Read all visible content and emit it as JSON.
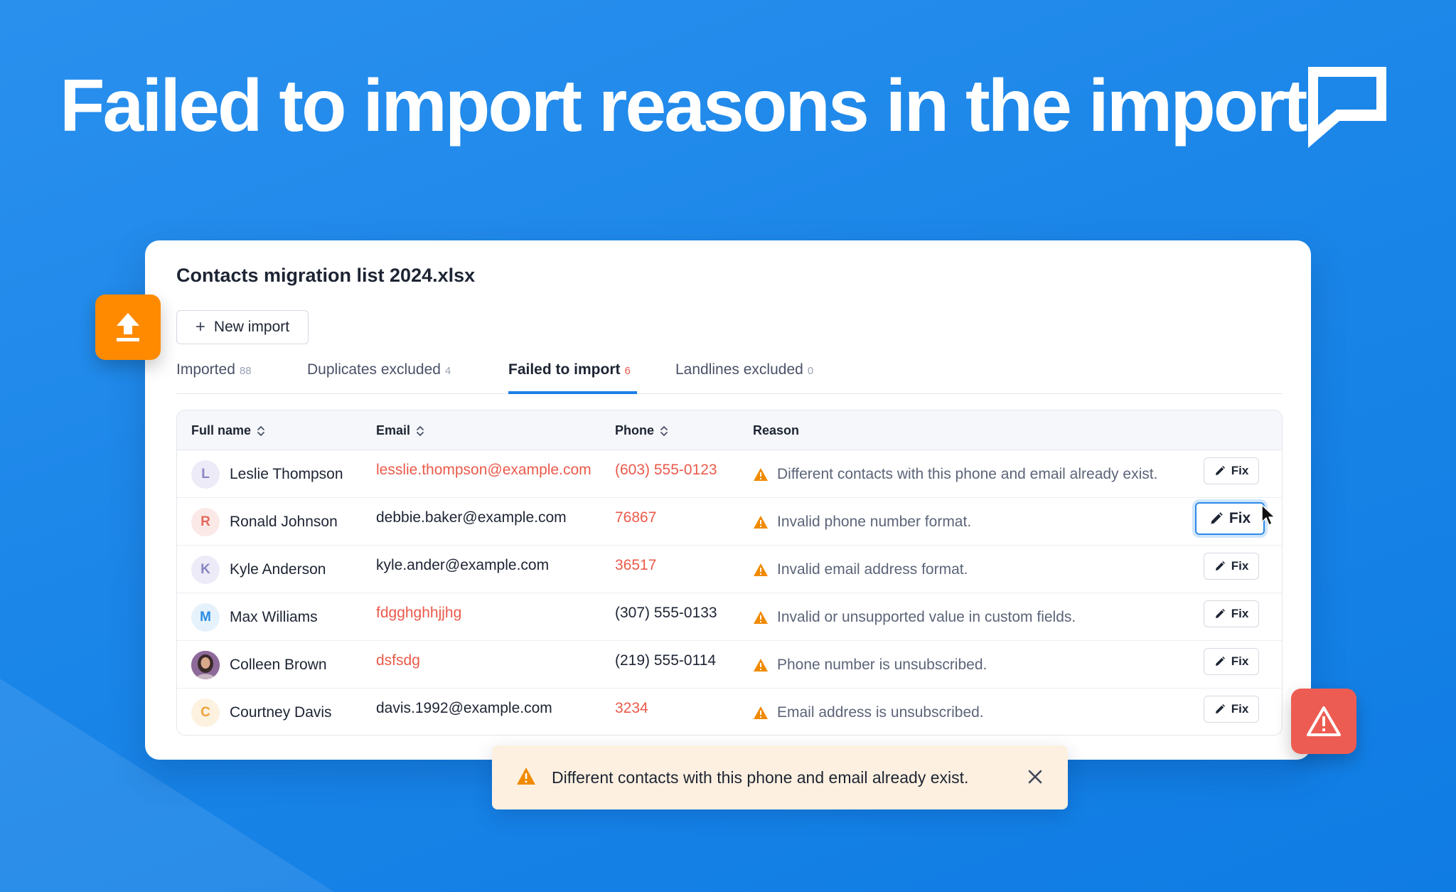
{
  "headline": "Failed to import reasons in the import",
  "colors": {
    "accent_blue": "#1a7fe6",
    "error_red": "#ea5a4a",
    "warning_orange": "#f08a00",
    "upload_orange": "#ff8a00",
    "alert_red": "#ed5c52",
    "toast_bg": "#fdf0e0"
  },
  "card": {
    "file_title": "Contacts migration list 2024.xlsx",
    "new_import_label": "New import",
    "tabs": [
      {
        "label": "Imported",
        "count": "88",
        "active": false
      },
      {
        "label": "Duplicates excluded",
        "count": "4",
        "active": false
      },
      {
        "label": "Failed to import",
        "count": "6",
        "active": true
      },
      {
        "label": "Landlines excluded",
        "count": "0",
        "active": false
      }
    ],
    "columns": {
      "full_name": "Full name",
      "email": "Email",
      "phone": "Phone",
      "reason": "Reason"
    },
    "fix_label": "Fix",
    "rows": [
      {
        "initial": "L",
        "name": "Leslie Thompson",
        "email": "lesslie.thompson@example.com",
        "email_error": true,
        "phone": "(603) 555-0123",
        "phone_error": true,
        "reason": "Different contacts with this phone and email already exist."
      },
      {
        "initial": "R",
        "name": "Ronald Johnson",
        "email": "debbie.baker@example.com",
        "email_error": false,
        "phone": "76867",
        "phone_error": true,
        "reason": "Invalid phone number format."
      },
      {
        "initial": "K",
        "name": "Kyle Anderson",
        "email": "kyle.ander@example.com",
        "email_error": false,
        "phone": "36517",
        "phone_error": true,
        "reason": "Invalid email address format."
      },
      {
        "initial": "M",
        "name": "Max Williams",
        "email": "fdgghghhjjhg",
        "email_error": true,
        "phone": "(307) 555-0133",
        "phone_error": false,
        "reason": "Invalid or unsupported value in custom fields."
      },
      {
        "initial": "",
        "name": "Colleen Brown",
        "email": "dsfsdg",
        "email_error": true,
        "phone": "(219) 555-0114",
        "phone_error": false,
        "reason": "Phone number is unsubscribed."
      },
      {
        "initial": "C",
        "name": "Courtney Davis",
        "email": "davis.1992@example.com",
        "email_error": false,
        "phone": "3234",
        "phone_error": true,
        "reason": "Email address is unsubscribed."
      }
    ]
  },
  "toast": {
    "message": "Different contacts with this phone and email already exist."
  },
  "icons": {
    "logo": "brand-flag-logo",
    "upload": "upload-arrow-icon",
    "alert": "warning-triangle-icon",
    "sort": "sort-chevrons-icon",
    "edit": "pencil-icon",
    "close": "close-icon"
  }
}
